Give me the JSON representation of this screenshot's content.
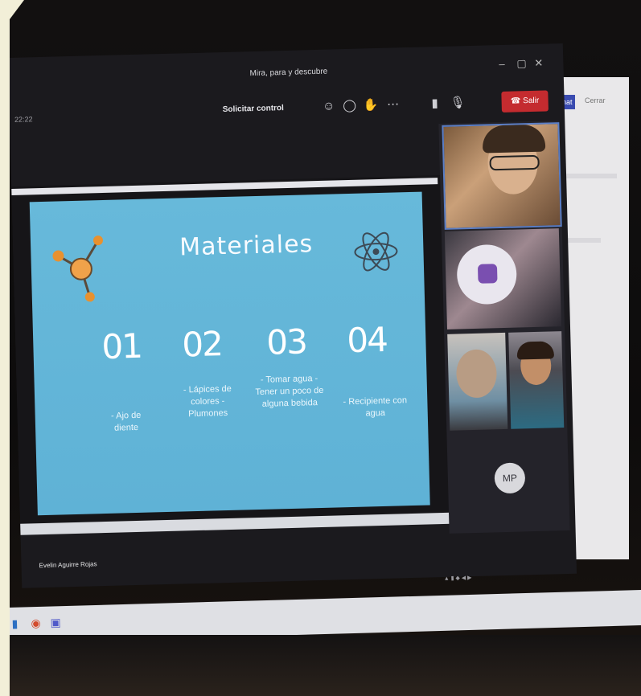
{
  "window": {
    "title": "Mira, para y descubre",
    "time": "22:22",
    "solicitar_label": "Solicitar control",
    "leave_label": "Salir"
  },
  "bg_app": {
    "tab_label": "Chat",
    "nav_text": "Cerrar"
  },
  "slide": {
    "title": "Materiales",
    "items": [
      {
        "number": "01",
        "text": "- Ajo de diente"
      },
      {
        "number": "02",
        "text": "- Lápices de colores - Plumones"
      },
      {
        "number": "03",
        "text": "- Tomar agua - Tener un poco de alguna bebida"
      },
      {
        "number": "04",
        "text": "- Recipiente con agua"
      }
    ]
  },
  "participants": {
    "avatar_initials": "MP"
  },
  "presenter_name": "Evelin Aguirre Rojas",
  "colors": {
    "slide_bg": "#62b4d8",
    "leave_red": "#c42b2f",
    "accent_blue": "#3a4bb0"
  }
}
